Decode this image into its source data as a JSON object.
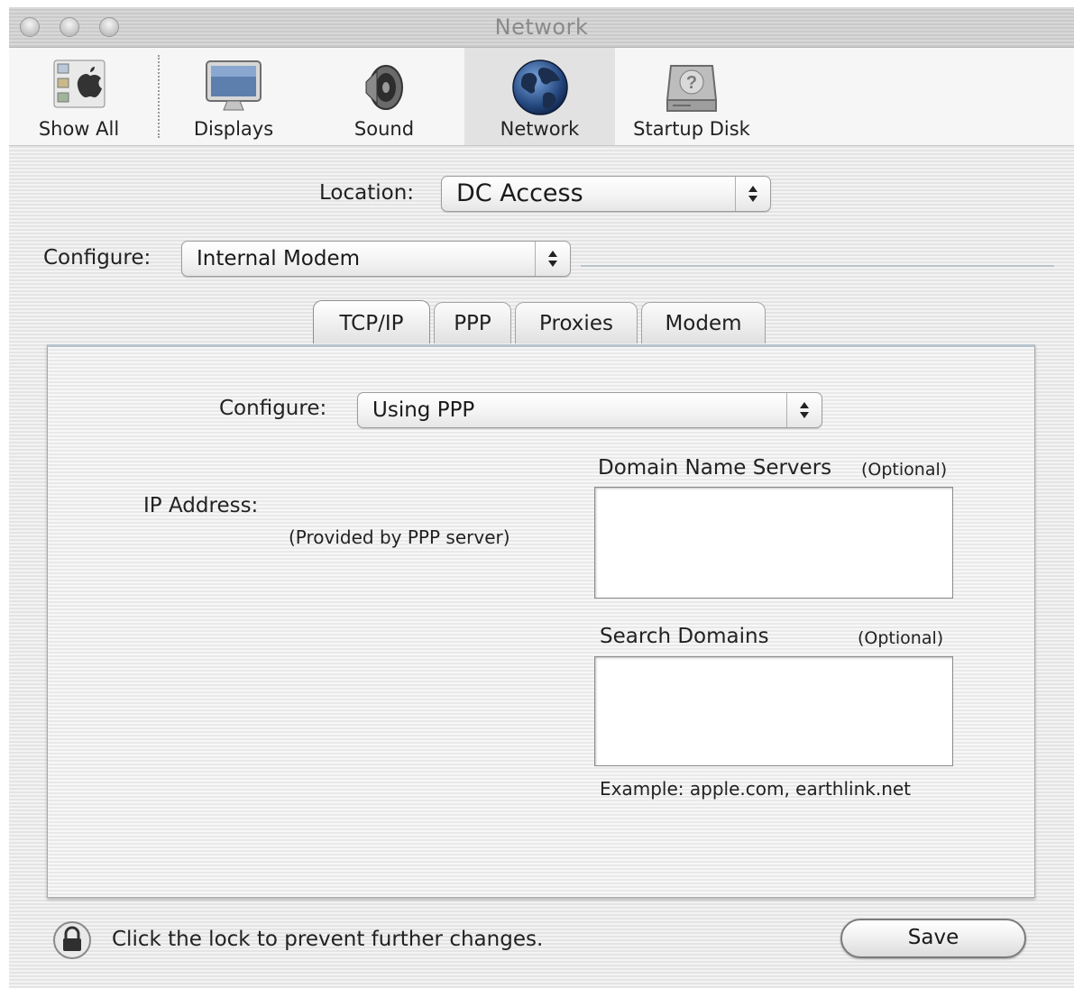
{
  "window": {
    "title": "Network"
  },
  "toolbar": {
    "items": [
      {
        "label": "Show All",
        "icon": "show-all-icon"
      },
      {
        "label": "Displays",
        "icon": "display-icon"
      },
      {
        "label": "Sound",
        "icon": "speaker-icon"
      },
      {
        "label": "Network",
        "icon": "globe-icon",
        "selected": true
      },
      {
        "label": "Startup Disk",
        "icon": "hard-disk-icon"
      }
    ]
  },
  "location": {
    "label": "Location:",
    "value": "DC Access"
  },
  "configure": {
    "label": "Configure:",
    "value": "Internal Modem"
  },
  "tabs": [
    {
      "label": "TCP/IP",
      "active": true
    },
    {
      "label": "PPP",
      "active": false
    },
    {
      "label": "Proxies",
      "active": false
    },
    {
      "label": "Modem",
      "active": false
    }
  ],
  "tcpip": {
    "configure_label": "Configure:",
    "configure_value": "Using PPP",
    "ip_address_label": "IP Address:",
    "ip_address_note": "(Provided by PPP server)",
    "dns_label": "Domain Name Servers",
    "dns_optional": "(Optional)",
    "dns_value": "",
    "search_label": "Search Domains",
    "search_optional": "(Optional)",
    "search_value": "",
    "example_text": "Example: apple.com, earthlink.net"
  },
  "footer": {
    "lock_text": "Click the lock to prevent further changes.",
    "save_label": "Save"
  },
  "colors": {
    "tab_accent": "#b8c4cd",
    "window_stripe": "#e4e4e4"
  }
}
